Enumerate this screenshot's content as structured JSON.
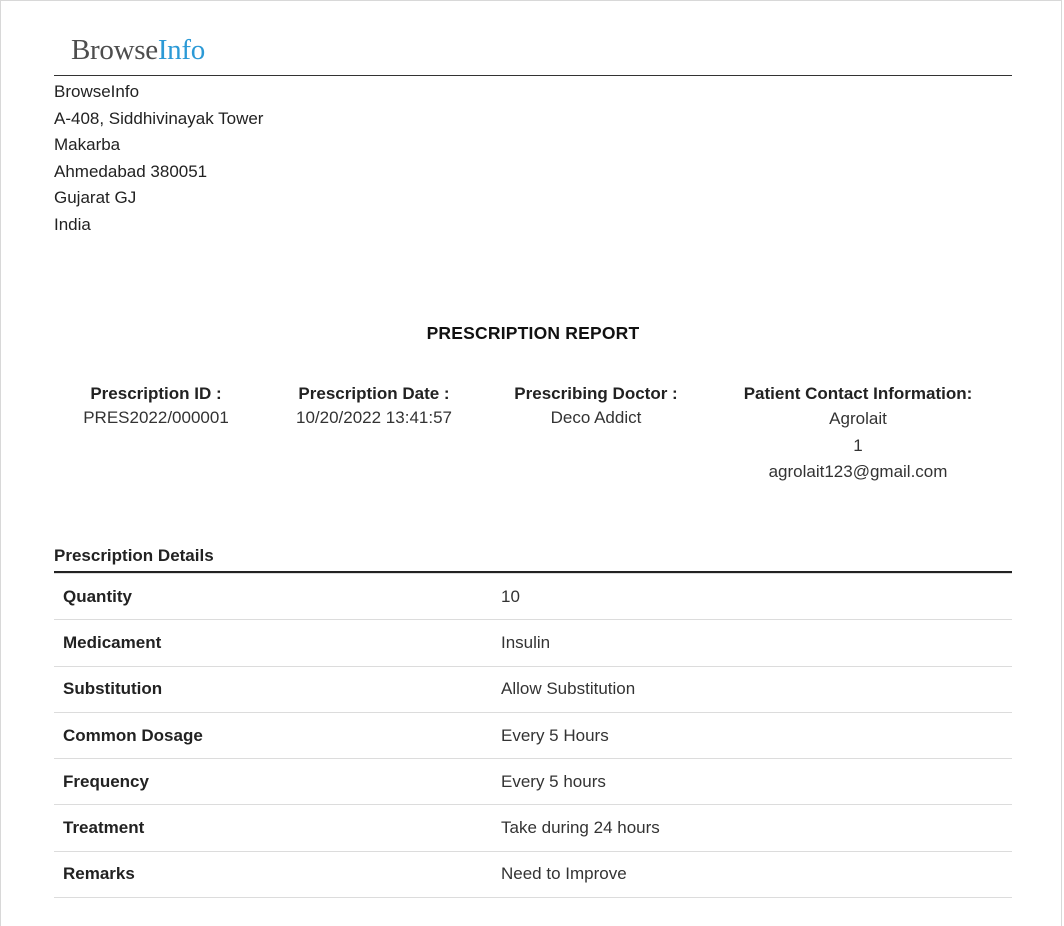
{
  "logo": {
    "part1": "Browse",
    "part2": "Info"
  },
  "company": {
    "lines": [
      "BrowseInfo",
      "A-408, Siddhivinayak Tower",
      "Makarba",
      "Ahmedabad 380051",
      "Gujarat GJ",
      "India"
    ]
  },
  "report": {
    "title": "PRESCRIPTION REPORT",
    "prescription_id_label": "Prescription ID :",
    "prescription_id": "PRES2022/000001",
    "prescription_date_label": "Prescription Date :",
    "prescription_date": "10/20/2022 13:41:57",
    "doctor_label": "Prescribing Doctor :",
    "doctor": "Deco Addict",
    "patient_label": "Patient Contact Information:",
    "patient_name": "Agrolait",
    "patient_phone": "1",
    "patient_email": "agrolait123@gmail.com"
  },
  "details": {
    "title": "Prescription Details",
    "rows": [
      {
        "label": "Quantity",
        "value": "10"
      },
      {
        "label": "Medicament",
        "value": "Insulin"
      },
      {
        "label": "Substitution",
        "value": "Allow Substitution"
      },
      {
        "label": "Common Dosage",
        "value": "Every 5 Hours"
      },
      {
        "label": "Frequency",
        "value": "Every 5 hours"
      },
      {
        "label": "Treatment",
        "value": "Take during 24 hours"
      },
      {
        "label": "Remarks",
        "value": "Need to Improve"
      }
    ]
  },
  "colors": {
    "logo_accent": "#2c9ad6",
    "logo_text": "#4d4d4d",
    "rule": "#333333"
  }
}
